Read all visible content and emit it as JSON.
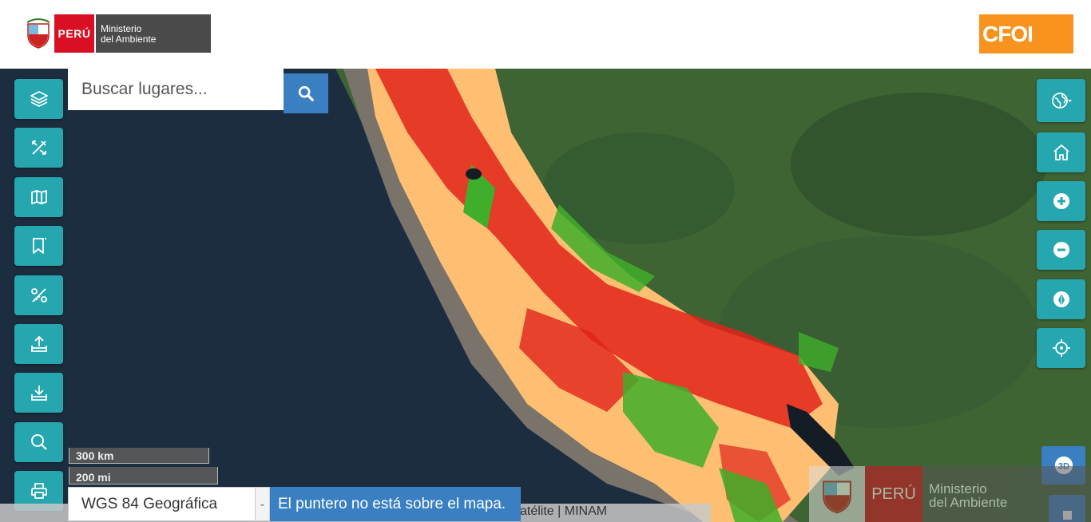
{
  "header": {
    "logo_country": "PERÚ",
    "logo_ministry_line1": "Ministerio",
    "logo_ministry_line2": "del Ambiente",
    "logo_right": "CFOI"
  },
  "search": {
    "placeholder": "Buscar lugares..."
  },
  "left_toolbar": [
    {
      "icon": "layers-icon"
    },
    {
      "icon": "draw-tools-icon"
    },
    {
      "icon": "map-icon"
    },
    {
      "icon": "bookmark-icon"
    },
    {
      "icon": "measure-icon"
    },
    {
      "icon": "upload-icon"
    },
    {
      "icon": "download-icon"
    },
    {
      "icon": "search-icon"
    },
    {
      "icon": "print-icon"
    }
  ],
  "right_toolbar": [
    {
      "icon": "basemap-globe-icon"
    },
    {
      "icon": "home-icon"
    },
    {
      "icon": "zoom-in-icon"
    },
    {
      "icon": "zoom-out-icon"
    },
    {
      "icon": "compass-icon"
    },
    {
      "icon": "locate-icon"
    },
    {
      "icon": "3d-icon",
      "label": "3D"
    },
    {
      "icon": "square-icon"
    }
  ],
  "scale": {
    "km": "300 km",
    "mi": "200 mi"
  },
  "attribution": "atélite | MINAM",
  "projection": {
    "selected": "WGS 84 Geográfica"
  },
  "pointer_status": "El puntero no está sobre el mapa.",
  "watermark": {
    "country": "PERÚ",
    "line1": "Ministerio",
    "line2": "del Ambiente"
  },
  "colors": {
    "toolbar": "#26a7b0",
    "accent_blue": "#3a7fc1",
    "peru_red": "#d91023",
    "cfoi_orange": "#f7931e",
    "class_high": "#e0231a",
    "class_medium": "#ffbf73",
    "class_low": "#3fae2a"
  }
}
